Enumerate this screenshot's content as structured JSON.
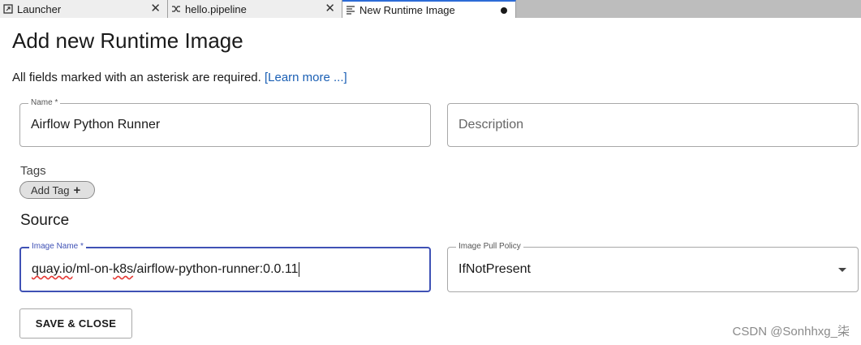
{
  "tabs": [
    {
      "label": "Launcher",
      "icon": "launcher-icon",
      "close": "✕"
    },
    {
      "label": "hello.pipeline",
      "icon": "pipeline-icon",
      "close": "✕"
    },
    {
      "label": "New Runtime Image",
      "icon": "editor-icon",
      "modified": true
    }
  ],
  "page": {
    "title": "Add new Runtime Image",
    "required_note": "All fields marked with an asterisk are required.",
    "learn_more": "[Learn more ...]"
  },
  "form": {
    "name": {
      "label": "Name *",
      "value": "Airflow Python Runner"
    },
    "description": {
      "placeholder": "Description"
    },
    "tags": {
      "label": "Tags",
      "add_label": "Add Tag",
      "add_icon": "+"
    },
    "source_heading": "Source",
    "image_name": {
      "label": "Image Name *",
      "value_misspelled": "quay.io",
      "value_mid": "/ml-on-",
      "value_misspelled2": "k8s",
      "value_rest": "/airflow-python-runner:0.0.11"
    },
    "pull_policy": {
      "label": "Image Pull Policy",
      "value": "IfNotPresent"
    }
  },
  "actions": {
    "save_close": "SAVE & CLOSE"
  },
  "watermark": "CSDN @Sonhhxg_柒",
  "colors": {
    "accent": "#3f51b5",
    "link": "#1a5fb4",
    "tab_active_border": "#2c6bd6"
  }
}
